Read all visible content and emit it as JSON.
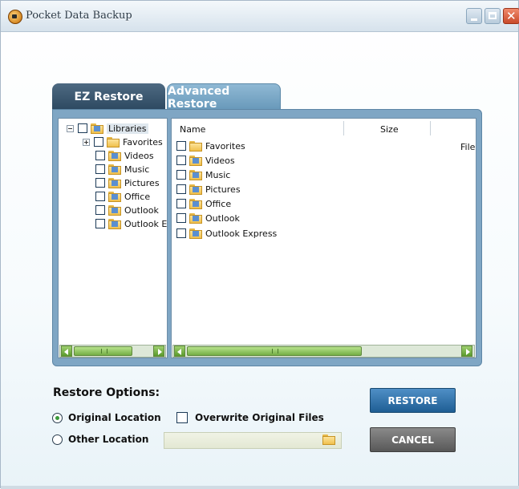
{
  "window": {
    "title": "Pocket Data Backup",
    "buttons": [
      "minimize",
      "maximize",
      "close"
    ],
    "close_glyph": "✕"
  },
  "tabs": [
    {
      "label": "EZ Restore",
      "active": false
    },
    {
      "label": "Advanced Restore",
      "active": true
    }
  ],
  "tree": {
    "root": {
      "label": "Libraries",
      "expanded": true,
      "checked": false
    },
    "children": [
      {
        "label": "Favorites",
        "expandable": true,
        "checked": false
      },
      {
        "label": "Videos",
        "checked": false
      },
      {
        "label": "Music",
        "checked": false
      },
      {
        "label": "Pictures",
        "checked": false
      },
      {
        "label": "Office",
        "checked": false
      },
      {
        "label": "Outlook",
        "checked": false
      },
      {
        "label": "Outlook E",
        "checked": false
      }
    ]
  },
  "list": {
    "columns": [
      "Name",
      "Size"
    ],
    "truncated_column_value": "File",
    "rows": [
      {
        "name": "Favorites",
        "checked": false
      },
      {
        "name": "Videos",
        "checked": false
      },
      {
        "name": "Music",
        "checked": false
      },
      {
        "name": "Pictures",
        "checked": false
      },
      {
        "name": "Office",
        "checked": false
      },
      {
        "name": "Outlook",
        "checked": false
      },
      {
        "name": "Outlook Express",
        "checked": false
      }
    ]
  },
  "restore_options": {
    "title": "Restore Options:",
    "original_location": {
      "label": "Original Location",
      "selected": true
    },
    "other_location": {
      "label": "Other Location",
      "selected": false
    },
    "overwrite": {
      "label": "Overwrite Original Files",
      "checked": false
    },
    "path_value": ""
  },
  "buttons": {
    "restore": "RESTORE",
    "cancel": "CANCEL"
  },
  "colors": {
    "tab_inactive": "#2c4860",
    "tab_active": "#6798b9",
    "panel": "#7fa6c4",
    "restore_button": "#1f5e94",
    "cancel_button": "#585858",
    "scrollbar": "#74ae45"
  },
  "icons": [
    "app-icon",
    "minimize-icon",
    "maximize-icon",
    "close-icon",
    "folder-icon",
    "library-icon",
    "expand-icon",
    "collapse-icon",
    "scroll-left-icon",
    "scroll-right-icon",
    "browse-folder-icon"
  ]
}
